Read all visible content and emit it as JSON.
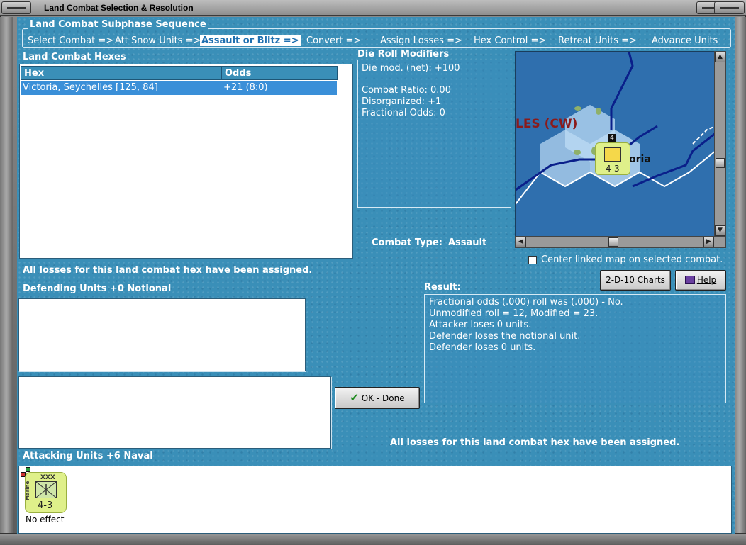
{
  "window": {
    "title": "Land Combat Selection & Resolution"
  },
  "sequence": {
    "title": "Land Combat Subphase Sequence",
    "steps": [
      "Select Combat =>",
      "Att Snow Units =>",
      "Assault or Blitz =>",
      "Convert =>",
      "Assign Losses =>",
      "Hex Control =>",
      "Retreat Units =>",
      "Advance Units"
    ],
    "active_index": 2
  },
  "hexes": {
    "title": "Land Combat Hexes",
    "columns": [
      "Hex",
      "Odds"
    ],
    "rows": [
      {
        "hex": "Victoria, Seychelles [125, 84]",
        "odds": "+21 (8:0)"
      }
    ]
  },
  "die_roll": {
    "title": "Die Roll Modifiers",
    "lines": [
      "Die mod. (net): +100",
      "",
      "Combat Ratio: 0.00",
      "Disorganized: +1",
      "Fractional Odds: 0"
    ]
  },
  "map": {
    "region_label": "LES (CW)",
    "city_label": "oria",
    "stack_count": "4",
    "unit_strength": "4-3",
    "colors": {
      "sea": "#2f6fae",
      "border": "#0a1f8a",
      "label": "#8b1a1a"
    }
  },
  "combat_type": {
    "label": "Combat Type:",
    "value": "Assault"
  },
  "center_map": {
    "label": "Center linked map on selected combat.",
    "checked": false
  },
  "buttons": {
    "charts": "2-D-10 Charts",
    "help": "Help",
    "ok": "OK - Done"
  },
  "status": {
    "losses_assigned_left": "All losses for this land combat hex have been assigned.",
    "losses_assigned_right": "All losses for this land combat hex have been assigned."
  },
  "defending": {
    "title": "Defending Units +0 Notional"
  },
  "attacking": {
    "title": "Attacking Units +6 Naval",
    "units": [
      {
        "type": "Marine",
        "size": "XXX",
        "strength": "4-3",
        "status": "No effect"
      }
    ]
  },
  "result": {
    "title": "Result:",
    "lines": [
      "Fractional odds (.000) roll was (.000)  - No.",
      "Unmodified roll = 12, Modified = 23.",
      "Attacker loses 0 units.",
      "Defender loses the notional unit.",
      "Defender loses 0 units."
    ]
  }
}
